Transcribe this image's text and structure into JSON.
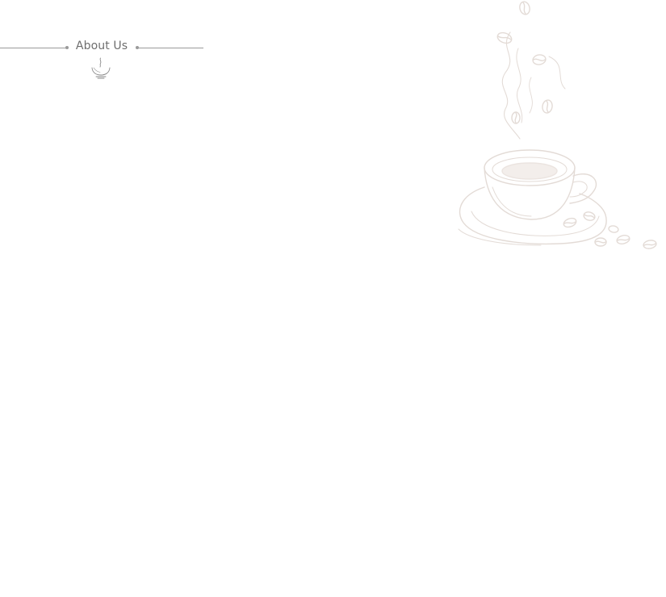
{
  "section": {
    "title": "About Us",
    "icon": "coffee-cup-icon"
  },
  "decoration": {
    "illustration": "coffee-cup-sketch",
    "color": "#e8e1dd"
  },
  "colors": {
    "background": "#ffffff",
    "heading_text": "#6e6e6e",
    "rule": "#9a9a9a"
  }
}
